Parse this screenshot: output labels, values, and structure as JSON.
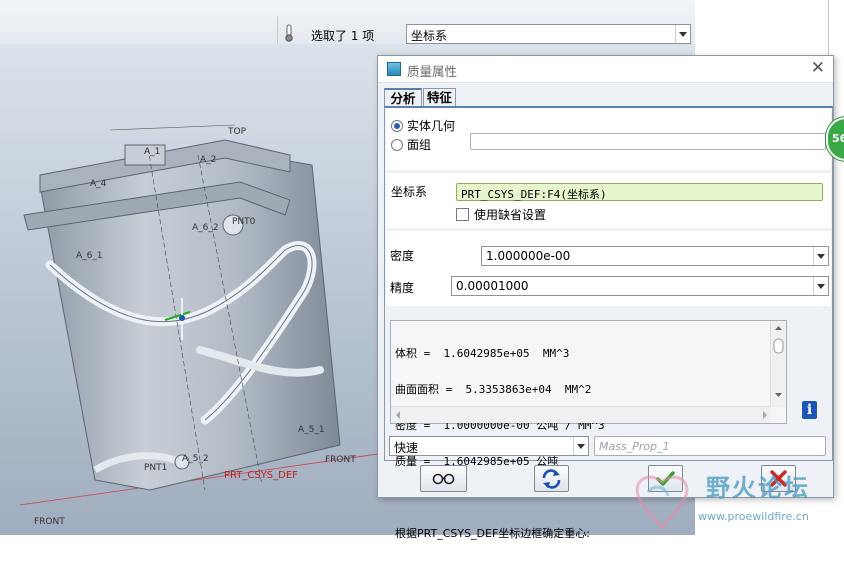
{
  "toolbar": {
    "selection_text": "选取了 1 项",
    "filter_value": "坐标系"
  },
  "model_labels": {
    "top": "TOP",
    "a1": "A_1",
    "a2": "A_2",
    "a4": "A_4",
    "a6_2": "A_6_2",
    "pnt0": "PNT0",
    "a6_1": "A_6_1",
    "a5_1": "A_5_1",
    "a5_2": "A_5_2",
    "pnt1": "PNT1",
    "csys": "PRT_CSYS_DEF",
    "front": "FRONT",
    "front2": "FRONT"
  },
  "dialog": {
    "title": "质量属性",
    "tabs": [
      "分析",
      "特征"
    ],
    "geometry_solid": "实体几何",
    "geometry_quilt": "面组",
    "csys_label": "坐标系",
    "csys_value": "PRT_CSYS_DEF:F4(坐标系)",
    "use_default_label": "使用缺省设置",
    "density_label": "密度",
    "density_value": "1.000000e-00",
    "accuracy_label": "精度",
    "accuracy_value": "0.00001000",
    "results": [
      "体积 =  1.6042985e+05  MM^3",
      "曲面面积 =  5.3353863e+04  MM^2",
      "密度 =  1.0000000e-00 公吨 / MM^3",
      "质量 =  1.6042985e+05 公吨",
      "",
      "根据PRT_CSYS_DEF坐标边框确定重心:"
    ],
    "mode_value": "快速",
    "name_placeholder": "Mass_Prop_1"
  },
  "badge": "56",
  "watermark": {
    "title": "野火论坛",
    "url": "www.proewildfire.cn"
  },
  "colors": {
    "accent": "#2b5fa7",
    "ok": "#2aa52a",
    "cancel": "#c62828",
    "csys_field": "#e8f6cf",
    "badge": "#39a845"
  }
}
